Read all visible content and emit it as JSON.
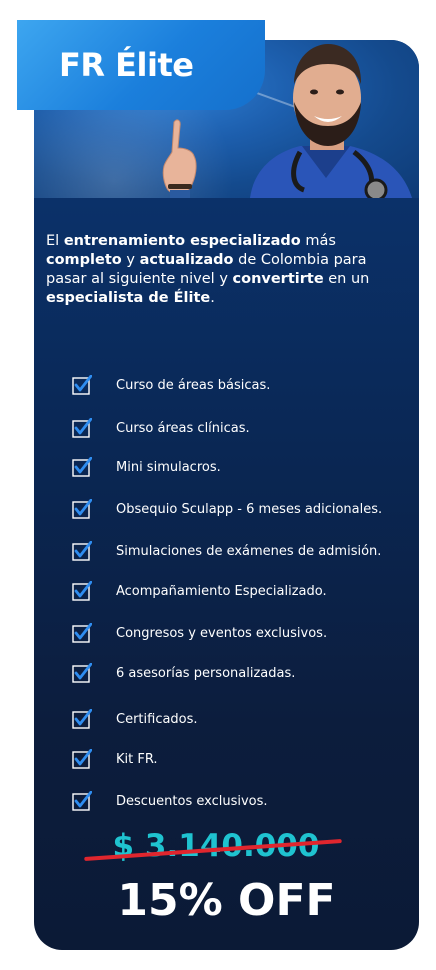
{
  "badge": {
    "title": "FR Élite"
  },
  "intro": {
    "segments": [
      {
        "text": "El ",
        "bold": false
      },
      {
        "text": "entrenamiento especializado",
        "bold": true
      },
      {
        "text": " más ",
        "bold": false
      },
      {
        "text": "completo",
        "bold": true
      },
      {
        "text": " y ",
        "bold": false
      },
      {
        "text": "actualizado",
        "bold": true
      },
      {
        "text": " de Colombia para pasar al siguiente nivel y ",
        "bold": false
      },
      {
        "text": "convertirte",
        "bold": true
      },
      {
        "text": " en un ",
        "bold": false
      },
      {
        "text": "especialista de Élite",
        "bold": true
      },
      {
        "text": ".",
        "bold": false
      }
    ]
  },
  "features": [
    "Curso de áreas básicas.",
    "Curso áreas clínicas.",
    "Mini simulacros.",
    "Obsequio Sculapp - 6 meses adicionales.",
    "Simulaciones de exámenes de admisión.",
    "Acompañamiento Especializado.",
    "Congresos y eventos exclusivos.",
    "6 asesorías personalizadas.",
    "Certificados.",
    "Kit FR.",
    "Descuentos exclusivos."
  ],
  "price": {
    "old": "$ 3.140.000",
    "discount": "15% OFF"
  },
  "colors": {
    "accent": "#1fc3d0",
    "strike": "#e0262e",
    "badge": "#1b7fdc"
  },
  "icons": {
    "check": "checkbox-checked-icon",
    "hand": "pointing-hand-icon"
  }
}
